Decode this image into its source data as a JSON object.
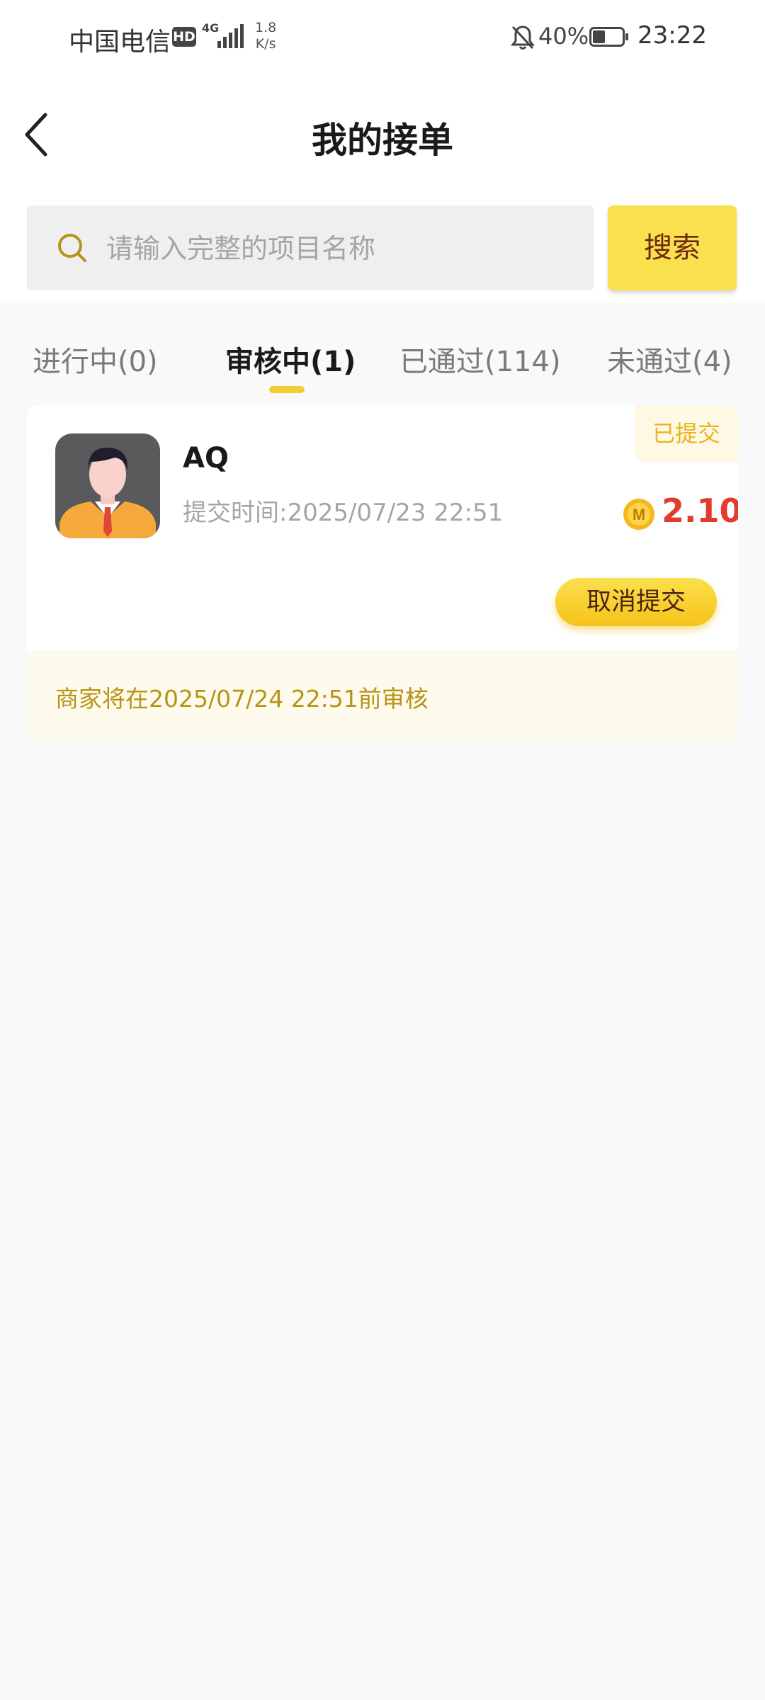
{
  "status_bar": {
    "carrier": "中国电信",
    "hd_badge": "HD",
    "network_type": "4G",
    "net_speed_value": "1.8",
    "net_speed_unit": "K/s",
    "battery_percent": "40%",
    "time": "23:22"
  },
  "header": {
    "title": "我的接单",
    "back_icon": "chevron-left-icon"
  },
  "search": {
    "placeholder": "请输入完整的项目名称",
    "value": "",
    "button_label": "搜索",
    "icon": "search-icon"
  },
  "tabs": [
    {
      "label": "进行中(0)",
      "active": false
    },
    {
      "label": "审核中(1)",
      "active": true
    },
    {
      "label": "已通过(114)",
      "active": false
    },
    {
      "label": "未通过(4)",
      "active": false
    }
  ],
  "orders": [
    {
      "name": "AQ",
      "status_badge": "已提交",
      "submit_time": "提交时间:2025/07/23 22:51",
      "coin_icon_letter": "M",
      "reward": "2.10",
      "action_label": "取消提交",
      "review_note": "商家将在2025/07/24 22:51前审核"
    }
  ],
  "colors": {
    "accent_yellow": "#fadf4f",
    "reward_red": "#e23b2e",
    "note_text": "#b79318",
    "badge_text": "#e8b520"
  }
}
